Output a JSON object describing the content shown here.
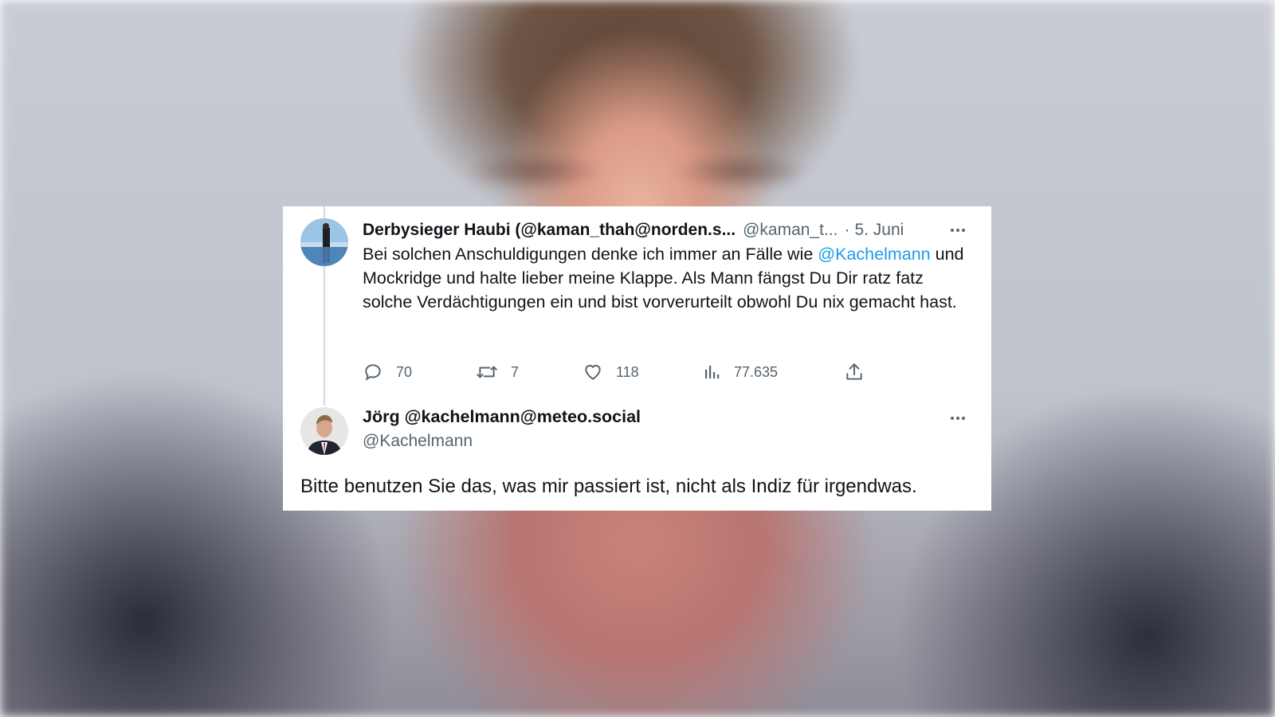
{
  "tweet1": {
    "display_name": "Derbysieger Haubi (@kaman_thah@norden.s...",
    "handle": "@kaman_t...",
    "dot": "·",
    "date": "5. Juni",
    "text_before": "Bei solchen Anschuldigungen denke ich immer an Fälle wie ",
    "mention": "@Kachelmann",
    "text_after": " und Mockridge und halte lieber meine Klappe. Als Mann fängst Du Dir ratz fatz solche Verdächtigungen ein und bist vorverurteilt obwohl Du nix gemacht hast.",
    "actions": {
      "replies": "70",
      "retweets": "7",
      "likes": "118",
      "views": "77.635"
    }
  },
  "tweet2": {
    "display_name": "Jörg @kachelmann@meteo.social",
    "handle": "@Kachelmann",
    "text": "Bitte benutzen Sie das, was mir passiert ist, nicht als Indiz für irgendwas."
  },
  "icons": {
    "reply": "reply-icon",
    "retweet": "retweet-icon",
    "like": "heart-icon",
    "views": "views-icon",
    "share": "share-icon",
    "more": "more-icon"
  },
  "colors": {
    "link": "#1d9bf0",
    "text": "#0f1419",
    "secondary": "#536471",
    "thread_line": "#cfd9de"
  }
}
